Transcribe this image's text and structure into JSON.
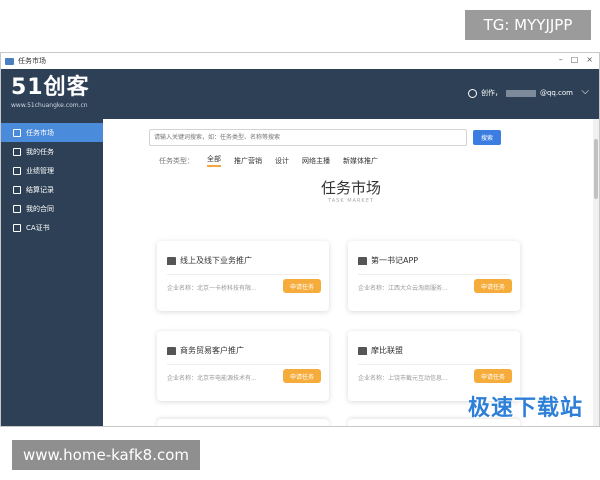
{
  "watermarks": {
    "tg": "TG: MYYJJPP",
    "url": "www.home-kafk8.com",
    "site": "极速下载站"
  },
  "window": {
    "title": "任务市场",
    "controls": [
      "–",
      "□",
      "×"
    ]
  },
  "header": {
    "logo": "51创客",
    "logo_url": "www.51chuangke.com.cn",
    "user_prefix": "创作，",
    "user_suffix": "@qq.com",
    "chevron": "⌵"
  },
  "sidebar": {
    "items": [
      {
        "label": "任务市场",
        "icon": "market-icon",
        "active": true
      },
      {
        "label": "我的任务",
        "icon": "tasks-icon",
        "active": false
      },
      {
        "label": "业绩管理",
        "icon": "performance-icon",
        "active": false
      },
      {
        "label": "结算记录",
        "icon": "settlement-icon",
        "active": false
      },
      {
        "label": "我的合同",
        "icon": "contract-icon",
        "active": false
      },
      {
        "label": "CA证书",
        "icon": "certificate-icon",
        "active": false
      }
    ]
  },
  "search": {
    "placeholder": "请输入关键词搜索，如：任务类型、名称等搜索",
    "button": "搜索"
  },
  "filter": {
    "label": "任务类型：",
    "tabs": [
      "全部",
      "推广营销",
      "设计",
      "网络主播",
      "新媒体推广"
    ]
  },
  "page": {
    "title": "任务市场",
    "subtitle": "TASK MARKET"
  },
  "cards": [
    {
      "title": "线上及线下业务推广",
      "company": "企业名称：北京一卡桥科技有限...",
      "button": "申请任务"
    },
    {
      "title": "第一书记APP",
      "company": "企业名称：江西大众云淘商服务...",
      "button": "申请任务"
    },
    {
      "title": "商务贸易客户推广",
      "company": "企业名称：北京市电能源技术有...",
      "button": "申请任务"
    },
    {
      "title": "摩比联盟",
      "company": "企业名称：上饶市截元互动信息...",
      "button": "申请任务"
    }
  ]
}
